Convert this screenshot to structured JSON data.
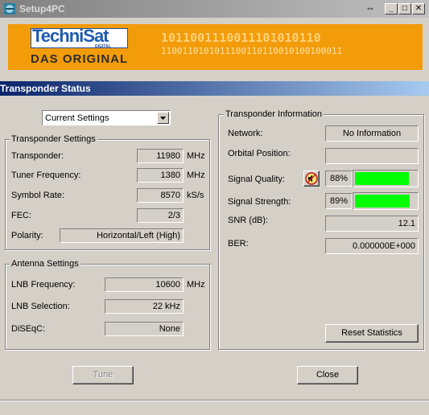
{
  "window": {
    "title": "Setup4PC",
    "restore_glyph": "⇔",
    "minimize_glyph": "_",
    "maximize_glyph": "□",
    "close_glyph": "✕"
  },
  "banner": {
    "logo": "TechniSat",
    "logo_sub": "DIGITAL",
    "tagline": "DAS ORIGINAL",
    "binary_line1": "1011001110011101010110",
    "binary_line2": "1100110101011100110110010100100011",
    "background_color": "#f39c0a",
    "logo_color": "#1e5bb0"
  },
  "section": {
    "title": "Transponder Status"
  },
  "settings_select": {
    "value": "Current Settings"
  },
  "transponder_settings": {
    "title": "Transponder Settings",
    "transponder": {
      "label": "Transponder:",
      "value": "11980",
      "unit": "MHz"
    },
    "tuner_frequency": {
      "label": "Tuner Frequency:",
      "value": "1380",
      "unit": "MHz"
    },
    "symbol_rate": {
      "label": "Symbol Rate:",
      "value": "8570",
      "unit": "kS/s"
    },
    "fec": {
      "label": "FEC:",
      "value": "2/3"
    },
    "polarity": {
      "label": "Polarity:",
      "value": "Horizontal/Left (High)"
    }
  },
  "antenna_settings": {
    "title": "Antenna Settings",
    "lnb_frequency": {
      "label": "LNB Frequency:",
      "value": "10600",
      "unit": "MHz"
    },
    "lnb_selection": {
      "label": "LNB Selection:",
      "value": "22 kHz"
    },
    "diseqc": {
      "label": "DiSEqC:",
      "value": "None"
    }
  },
  "transponder_information": {
    "title": "Transponder Information",
    "network": {
      "label": "Network:",
      "value": "No Information"
    },
    "orbital_position": {
      "label": "Orbital Position:",
      "value": ""
    },
    "signal_quality": {
      "label": "Signal Quality:",
      "value": "88%",
      "level": 0.88
    },
    "signal_strength": {
      "label": "Signal Strength:",
      "value": "89%",
      "level": 0.89
    },
    "snr": {
      "label": "SNR (dB):",
      "value": "12.1"
    },
    "ber": {
      "label": "BER:",
      "value": "0.000000E+000"
    },
    "reset_button": "Reset Statistics",
    "bar_color": "#00ff00",
    "speaker_icon": "speaker-mute-icon"
  },
  "buttons": {
    "tune": "Tune",
    "close": "Close"
  }
}
